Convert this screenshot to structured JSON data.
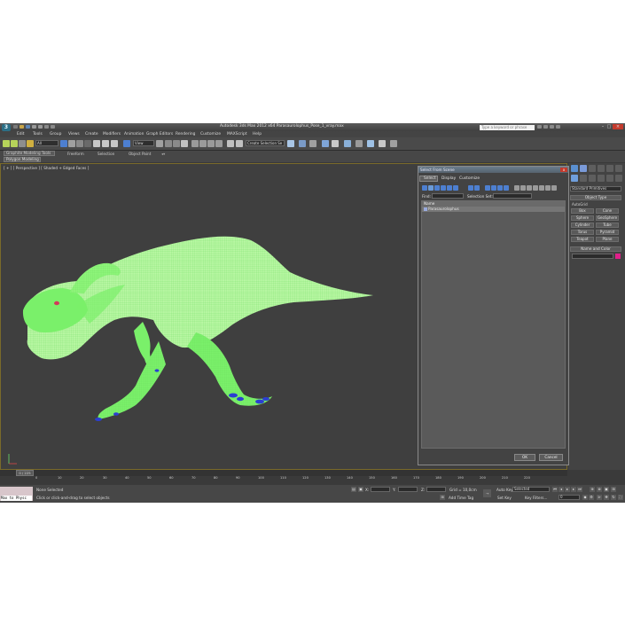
{
  "app": {
    "logo": "3",
    "title": "Autodesk 3ds Max  2012 x64     Parasaurolophus_Pose_1_vray.max",
    "search_placeholder": "Type a keyword or phrase"
  },
  "menubar": [
    "Edit",
    "Tools",
    "Group",
    "Views",
    "Create",
    "Modifiers",
    "Animation",
    "Graph Editors",
    "Rendering",
    "Customize",
    "MAXScript",
    "Help"
  ],
  "toolbar": {
    "filter_value": "All",
    "view_value": "View",
    "selection_set_value": "Create Selection Se"
  },
  "ribbon": {
    "tabs": [
      "Graphite Modeling Tools",
      "Freeform",
      "Selection",
      "Object Paint"
    ],
    "active_tab": "Graphite Modeling Tools",
    "panel": "Polygon Modeling"
  },
  "viewport": {
    "label": "[ + ] [ Perspective ] [ Shaded + Edged Faces ]",
    "model_color": "#7af06a",
    "background": "#3f3f3f"
  },
  "command_panel": {
    "dropdown": "Standard Primitives",
    "object_type_title": "Object Type",
    "autogrid_label": "AutoGrid",
    "primitives": [
      "Box",
      "Cone",
      "Sphere",
      "GeoSphere",
      "Cylinder",
      "Tube",
      "Torus",
      "Pyramid",
      "Teapot",
      "Plane"
    ],
    "name_color_title": "Name and Color",
    "swatch_color": "#e01f8a"
  },
  "dialog": {
    "title": "Select From Scene",
    "close_label": "x",
    "menus": [
      "Select",
      "Display",
      "Customize"
    ],
    "find_label": "Find:",
    "selection_set_label": "Selection Set:",
    "column_header": "Name",
    "rows": [
      "Parasaurolophus"
    ],
    "ok_label": "OK",
    "cancel_label": "Cancel"
  },
  "timeline": {
    "frame_label": "0 / 225",
    "ticks": [
      "0",
      "10",
      "20",
      "30",
      "40",
      "50",
      "60",
      "70",
      "80",
      "90",
      "100",
      "110",
      "120",
      "130",
      "140",
      "150",
      "160",
      "170",
      "180",
      "190",
      "200",
      "210",
      "220"
    ]
  },
  "statusbar": {
    "maxscript_text": "Max to Physc",
    "status_text": "None Selected",
    "prompt_text": "Click or click-and-drag to select objects",
    "x_label": "X:",
    "y_label": "Y:",
    "z_label": "Z:",
    "grid_label": "Grid = 10,0cm",
    "add_time_tag": "Add Time Tag",
    "auto_key": "Auto Key",
    "auto_key_value": "Selected",
    "set_key": "Set Key",
    "key_filters": "Key Filters...",
    "frame_value": "0"
  }
}
